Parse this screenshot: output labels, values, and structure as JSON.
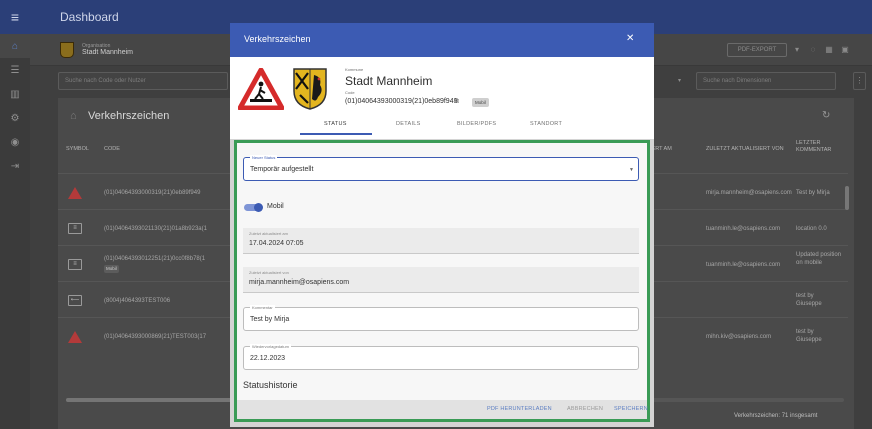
{
  "topbar": {
    "title": "Dashboard",
    "menu_icon": "menu-icon"
  },
  "rail": {
    "items": [
      "home-icon",
      "users-icon",
      "chart-icon",
      "settings-icon",
      "account-icon",
      "export-icon"
    ]
  },
  "org": {
    "label": "Organisation",
    "name": "Stadt Mannheim"
  },
  "toolbar": {
    "pdf_export": "PDF-EXPORT"
  },
  "search": {
    "left_placeholder": "Suche nach Code oder Nutzer",
    "right_placeholder": "Suche nach Dimensionen"
  },
  "panel": {
    "title": "Verkehrszeichen"
  },
  "table": {
    "headers": {
      "symbol": "SYMBOL",
      "code": "CODE",
      "created": "IERT AM",
      "updated_by": "ZULETZT AKTUALISIERT VON",
      "last_comment": "LETZTER KOMMENTAR"
    },
    "rows": [
      {
        "code": "(01)04064393000319(21)0eb89f949",
        "updated_by": "mirja.mannheim@osapiens.com",
        "comment": "Test by Mirja",
        "chip": ""
      },
      {
        "code": "(01)04064393021130(21)01a8b923a(1",
        "updated_by": "tuanminh.le@osapiens.com",
        "comment": "location 0.0",
        "chip": ""
      },
      {
        "code": "(01)04064393012251(21)0cc0f8b78(1",
        "updated_by": "tuanminh.le@osapiens.com",
        "comment": "Updated position on mobile",
        "chip": "Mobil"
      },
      {
        "code": "(8004)4064393TEST006",
        "updated_by": "",
        "comment": "test by Giuseppe",
        "chip": ""
      },
      {
        "code": "(01)04064393000869(21)TEST003(17",
        "updated_by": "mihn.kiv@osapiens.com",
        "comment": "test by Giuseppe",
        "chip": ""
      }
    ],
    "footer": "Verkehrszeichen: 71 insgesamt"
  },
  "dialog": {
    "title": "Verkehrszeichen",
    "kommune_label": "Kommune",
    "kommune_name": "Stadt Mannheim",
    "code_label": "Code",
    "code": "(01)04064393000319(21)0eb89f949",
    "chip": "Mobil",
    "tabs": [
      "STATUS",
      "DETAILS",
      "BILDER/PDFS",
      "STANDORT"
    ],
    "status_label": "Neuer Status",
    "status_value": "Temporär aufgestellt",
    "toggle_label": "Mobil",
    "updated_at_label": "Zuletzt aktualisiert am",
    "updated_at": "17.04.2024 07:05",
    "updated_by_label": "Zuletzt aktualisiert von",
    "updated_by": "mirja.mannheim@osapiens.com",
    "comment_label": "Kommentar",
    "comment": "Test by Mirja",
    "resubmit_label": "Wiedervorlagedatum",
    "resubmit": "22.12.2023",
    "history_title": "Statushistorie",
    "actions": {
      "download": "PDF HERUNTERLADEN",
      "cancel": "ABBRECHEN",
      "save": "SPEICHERN"
    }
  },
  "colors": {
    "brand": "#3c5bb3",
    "highlight": "#3a9b56",
    "warning": "#b33a3a"
  }
}
